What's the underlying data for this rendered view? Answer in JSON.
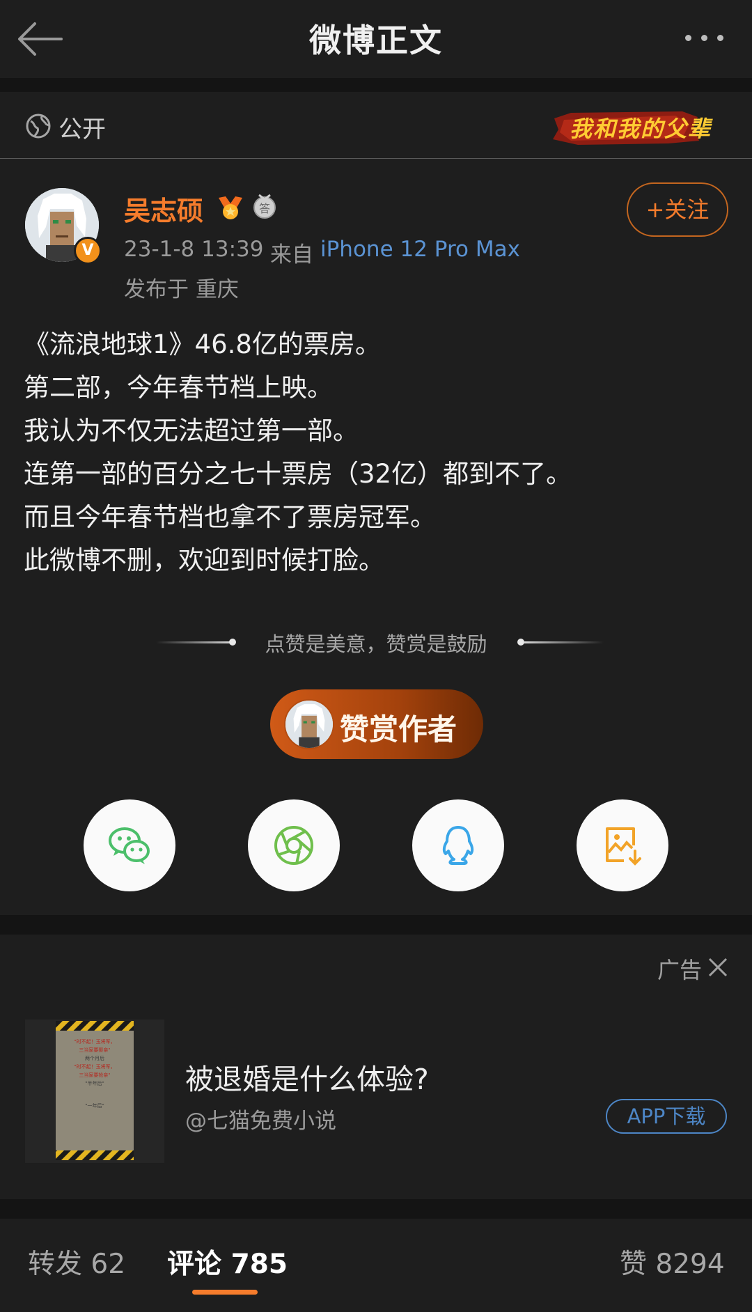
{
  "header": {
    "title": "微博正文",
    "back_icon": "arrow-left-icon",
    "more_icon": "more-dots-icon"
  },
  "visibility": {
    "label": "公开",
    "icon": "globe-icon",
    "banner_text": "我和我的父辈"
  },
  "author": {
    "name": "吴志硕",
    "verified_badge": "V",
    "time": "23-1-8 13:39",
    "source_label": "来自",
    "device": "iPhone 12 Pro Max",
    "location": "发布于 重庆",
    "follow_label": "+关注",
    "name_color": "#f57c2c"
  },
  "post": {
    "lines": [
      "《流浪地球1》46.8亿的票房。",
      "第二部，今年春节档上映。",
      "我认为不仅无法超过第一部。",
      "连第一部的百分之七十票房（32亿）都到不了。",
      "而且今年春节档也拿不了票房冠军。",
      "此微博不删，欢迎到时候打脸。"
    ]
  },
  "reward": {
    "hint": "点赞是美意，赞赏是鼓励",
    "button_label": "赞赏作者"
  },
  "share": {
    "items": [
      {
        "name": "wechat-icon",
        "color": "#4cbf6b"
      },
      {
        "name": "moments-icon",
        "color": "#6fbf4c"
      },
      {
        "name": "qq-icon",
        "color": "#3aa6e8"
      },
      {
        "name": "save-image-icon",
        "color": "#f2a328"
      }
    ]
  },
  "ad": {
    "tag": "广告",
    "title": "被退婚是什么体验?",
    "source": "@七猫免费小说",
    "button_label": "APP下载",
    "poster_lines": [
      "\"时不起！玉将军，",
      "三当家要娶亲\"",
      "两个月后",
      "\"时不起！玉将军，",
      "三当家要抢亲\"",
      "\"半年后\"",
      "\"一年后\""
    ]
  },
  "tabs": {
    "repost": "转发 62",
    "comment": "评论 785",
    "like": "赞 8294",
    "active": "comment",
    "accent": "#f57c2c"
  }
}
